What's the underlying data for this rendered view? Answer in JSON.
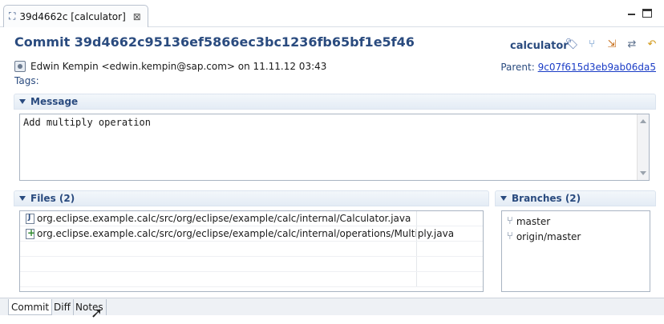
{
  "editor_tab": {
    "label": "39d4662c [calculator]",
    "close": "⊠"
  },
  "commit": {
    "title": "Commit 39d4662c95136ef5866ec3bc1236fb65bf1e5f46",
    "repo": "calculator",
    "author": "Edwin Kempin <edwin.kempin@sap.com> on 11.11.12 03:43",
    "parent_label": "Parent:",
    "parent_hash": "9c07f615d3eb9ab06da5",
    "tags_label": "Tags:"
  },
  "message_section": {
    "title": "Message",
    "text": "Add multiply operation"
  },
  "files_section": {
    "title": "Files (2)",
    "files": [
      {
        "name": "org.eclipse.example.calc/src/org/eclipse/example/calc/internal/Calculator.java"
      },
      {
        "name": "org.eclipse.example.calc/src/org/eclipse/example/calc/internal/operations/Multiply.java"
      }
    ]
  },
  "branches_section": {
    "title": "Branches (2)",
    "branches": [
      {
        "name": "master"
      },
      {
        "name": "origin/master"
      }
    ]
  },
  "bottom_tabs": [
    {
      "label": "Commit"
    },
    {
      "label": "Diff"
    },
    {
      "label": "Notes"
    }
  ],
  "toolbar_icons": [
    "create-tag-icon",
    "create-branch-icon",
    "checkout-icon",
    "cherry-pick-icon",
    "revert-icon"
  ],
  "colors": {
    "header_text": "#2a4b7f",
    "link": "#1a3cc6",
    "section_bg": "#e4ecf5"
  }
}
